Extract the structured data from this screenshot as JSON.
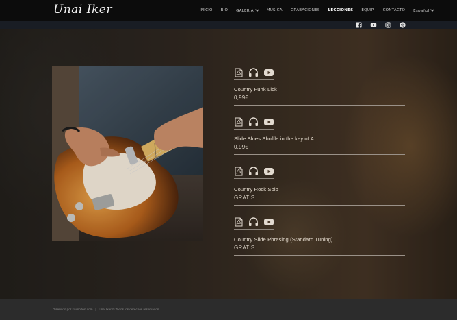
{
  "header": {
    "logo_text": "Unai Iker",
    "nav": [
      {
        "label": "INICIO",
        "active": false,
        "dropdown": false
      },
      {
        "label": "BIO",
        "active": false,
        "dropdown": false
      },
      {
        "label": "GALERIA",
        "active": false,
        "dropdown": true
      },
      {
        "label": "MÚSICA",
        "active": false,
        "dropdown": false
      },
      {
        "label": "GRABACIONES",
        "active": false,
        "dropdown": false
      },
      {
        "label": "LECCIONES",
        "active": true,
        "dropdown": false
      },
      {
        "label": "EQUIP.",
        "active": false,
        "dropdown": false
      },
      {
        "label": "CONTACTO",
        "active": false,
        "dropdown": false
      },
      {
        "label": "Español",
        "active": false,
        "dropdown": true
      }
    ],
    "social": [
      "facebook-icon",
      "youtube-icon",
      "instagram-icon",
      "spotify-icon"
    ]
  },
  "lessons": [
    {
      "title": "Country Funk Lick",
      "price": "0,99€"
    },
    {
      "title": "Slide Blues Shuffle in the key of A",
      "price": "0,99€"
    },
    {
      "title": "Country Rock Solo",
      "price": "GRATIS"
    },
    {
      "title": "Country Slide Phrasing (Standard Tuning)",
      "price": "GRATIS"
    }
  ],
  "lesson_icons": [
    "pdf-icon",
    "headphones-icon",
    "youtube-icon"
  ],
  "footer": {
    "designer": "Diseñado por kaimoden.com",
    "separator": "|",
    "copyright": "Unai Iker © Todos los derechos reservados"
  },
  "colors": {
    "header_bg": "#0c0c0c",
    "social_bar_bg": "#191d24",
    "footer_bg": "#2c2c2c",
    "text": "#e6ddd0"
  }
}
